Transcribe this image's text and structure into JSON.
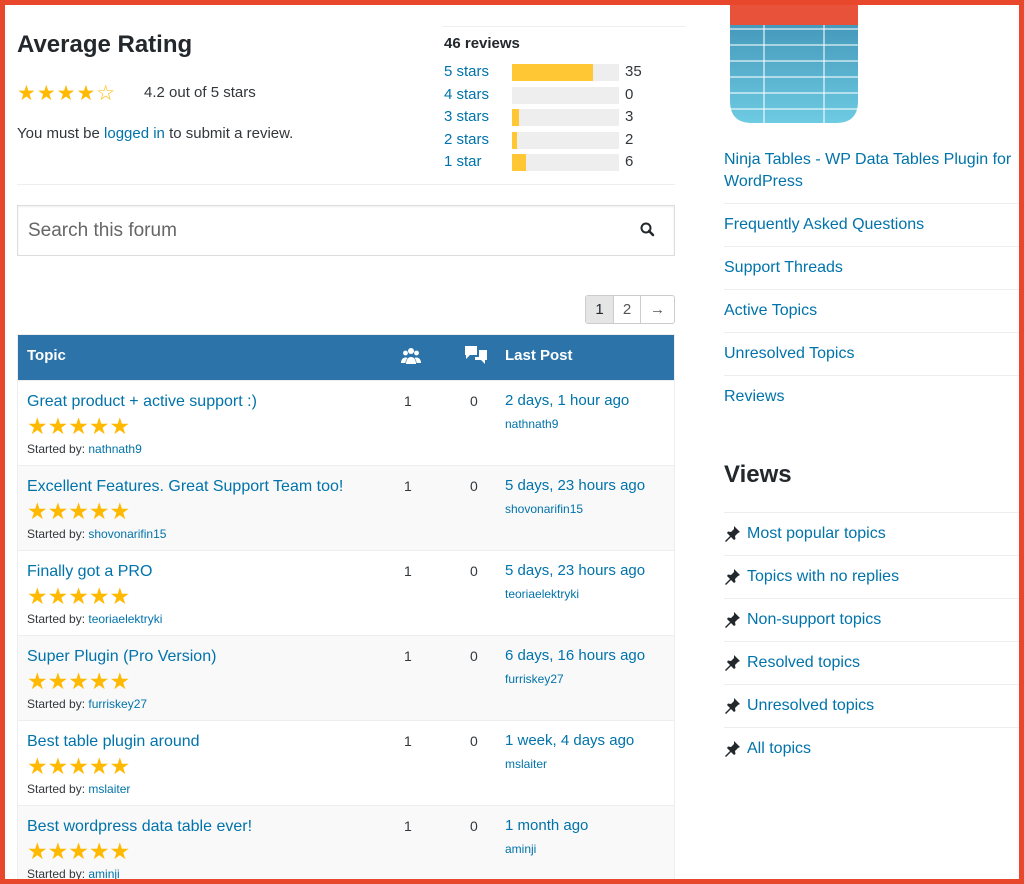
{
  "rating": {
    "title": "Average Rating",
    "stars_display": "★★★★☆",
    "summary": "4.2 out of 5 stars",
    "login_prefix": "You must be ",
    "login_link": "logged in",
    "login_suffix": " to submit a review.",
    "reviews_count": "46 reviews",
    "breakdown": [
      {
        "label": "5 stars",
        "count": "35",
        "fraction": 0.76
      },
      {
        "label": "4 stars",
        "count": "0",
        "fraction": 0.0
      },
      {
        "label": "3 stars",
        "count": "3",
        "fraction": 0.065
      },
      {
        "label": "2 stars",
        "count": "2",
        "fraction": 0.043
      },
      {
        "label": "1 star",
        "count": "6",
        "fraction": 0.13
      }
    ]
  },
  "search": {
    "placeholder": "Search this forum"
  },
  "pagination": {
    "pages": [
      "1",
      "2"
    ],
    "next": "→",
    "current": "1"
  },
  "table": {
    "col_topic": "Topic",
    "col_last_post": "Last Post",
    "rows": [
      {
        "title": "Great product + active support :)",
        "stars": "★★★★★",
        "started_label": "Started by: ",
        "author": "nathnath9",
        "voices": "1",
        "posts": "0",
        "last": "2 days, 1 hour ago",
        "last_user": "nathnath9"
      },
      {
        "title": "Excellent Features. Great Support Team too!",
        "stars": "★★★★★",
        "started_label": "Started by: ",
        "author": "shovonarifin15",
        "voices": "1",
        "posts": "0",
        "last": "5 days, 23 hours ago",
        "last_user": "shovonarifin15"
      },
      {
        "title": "Finally got a PRO",
        "stars": "★★★★★",
        "started_label": "Started by: ",
        "author": "teoriaelektryki",
        "voices": "1",
        "posts": "0",
        "last": "5 days, 23 hours ago",
        "last_user": "teoriaelektryki"
      },
      {
        "title": "Super Plugin (Pro Version)",
        "stars": "★★★★★",
        "started_label": "Started by: ",
        "author": "furriskey27",
        "voices": "1",
        "posts": "0",
        "last": "6 days, 16 hours ago",
        "last_user": "furriskey27"
      },
      {
        "title": "Best table plugin around",
        "stars": "★★★★★",
        "started_label": "Started by: ",
        "author": "mslaiter",
        "voices": "1",
        "posts": "0",
        "last": "1 week, 4 days ago",
        "last_user": "mslaiter"
      },
      {
        "title": "Best wordpress data table ever!",
        "stars": "★★★★★",
        "started_label": "Started by: ",
        "author": "aminji",
        "voices": "1",
        "posts": "0",
        "last": "1 month ago",
        "last_user": "aminji"
      }
    ]
  },
  "sidebar": {
    "plugin_name": "Ninja Tables - WP Data Tables Plugin for WordPress",
    "links": [
      "Frequently Asked Questions",
      "Support Threads",
      "Active Topics",
      "Unresolved Topics",
      "Reviews"
    ],
    "views_title": "Views",
    "views": [
      "Most popular topics",
      "Topics with no replies",
      "Non-support topics",
      "Resolved topics",
      "Unresolved topics",
      "All topics"
    ]
  },
  "colors": {
    "link": "#0073aa",
    "header": "#2b73a9",
    "star": "#ffb900",
    "bar_fill": "#ffc733",
    "frame": "#e8472b"
  },
  "icons": [
    "search-icon",
    "voices-icon",
    "replies-icon",
    "pin-icon",
    "plugin-table-icon"
  ]
}
